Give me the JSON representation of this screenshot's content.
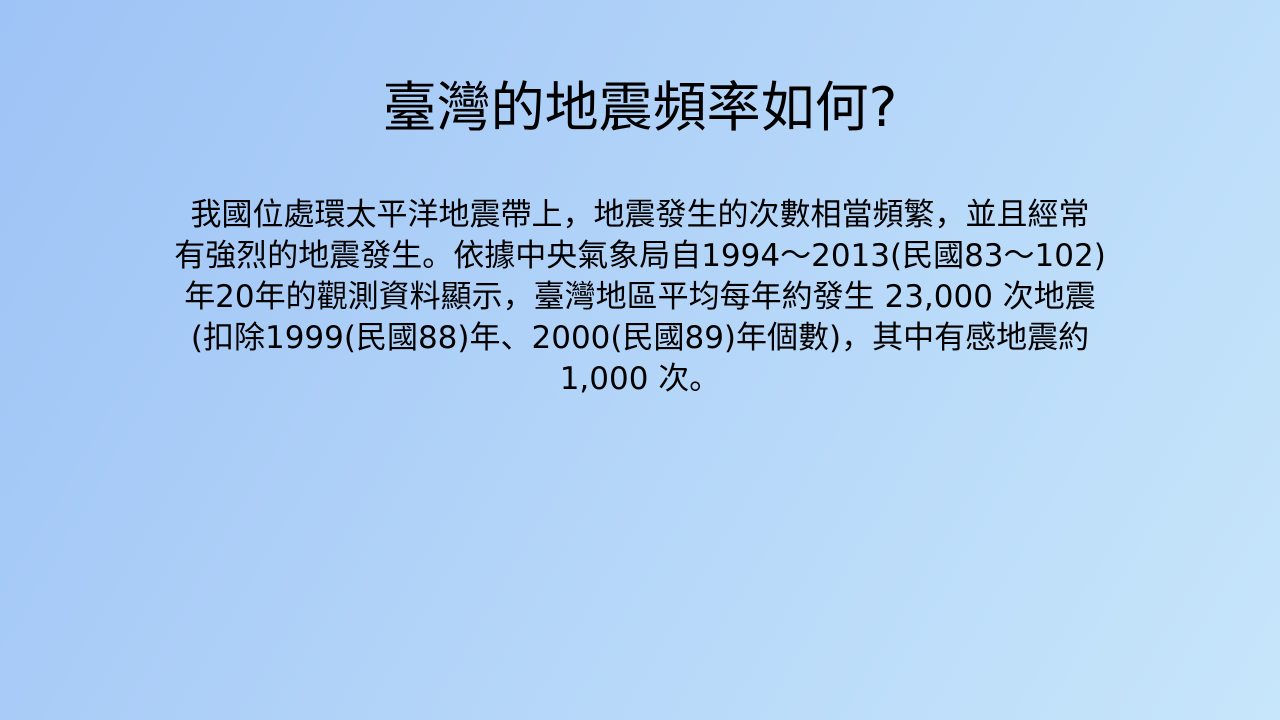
{
  "slide": {
    "title": "臺灣的地震頻率如何?",
    "body_lines": [
      "我國位處環太平洋地震帶上，地震發生的次數相當頻繁，並且經常",
      "有強烈的地震發生。依據中央氣象局自1994～2013(民國83～102)",
      "年20年的觀測資料顯示，臺灣地區平均每年約發生 23,000 次地震",
      "(扣除1999(民國88)年、2000(民國89)年個數)，其中有感地震約",
      "1,000 次。"
    ],
    "background_colors": [
      "#9ec3f6",
      "#b1d3f8",
      "#c7e6fb"
    ]
  }
}
